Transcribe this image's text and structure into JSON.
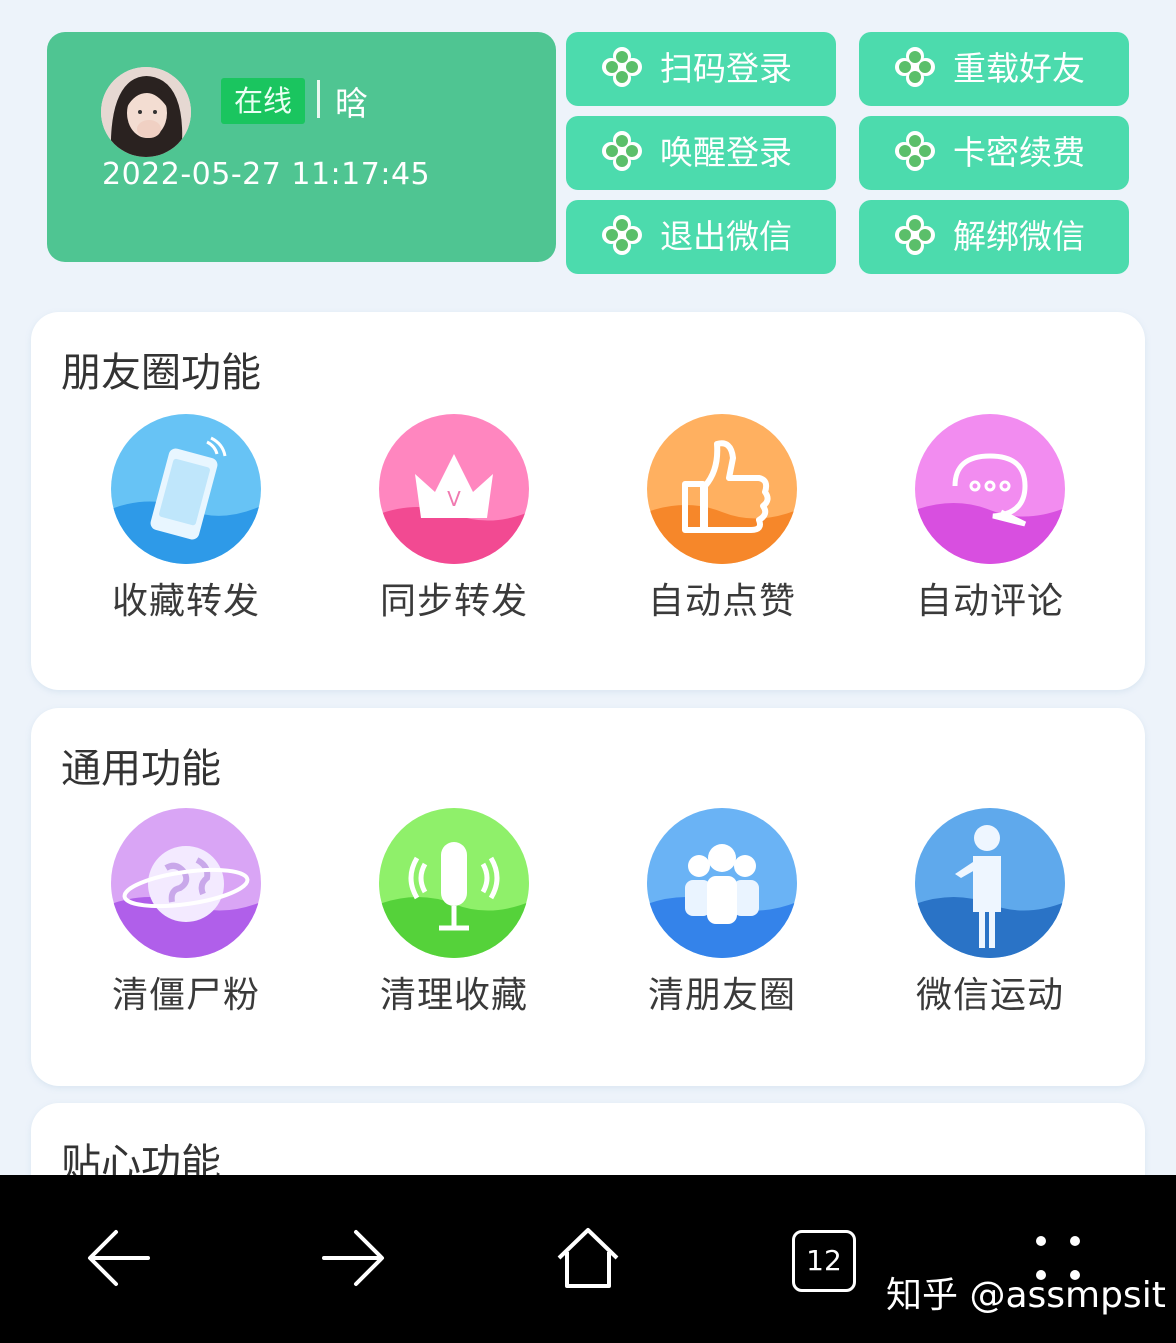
{
  "profile": {
    "status": "在线",
    "nickname": "晗",
    "login_time": "2022-05-27 11:17:45"
  },
  "actions": [
    {
      "label": "扫码登录",
      "icon": "clover-icon"
    },
    {
      "label": "重载好友",
      "icon": "clover-icon"
    },
    {
      "label": "唤醒登录",
      "icon": "clover-icon"
    },
    {
      "label": "卡密续费",
      "icon": "clover-icon"
    },
    {
      "label": "退出微信",
      "icon": "clover-icon"
    },
    {
      "label": "解绑微信",
      "icon": "clover-icon"
    }
  ],
  "sections": [
    {
      "title": "朋友圈功能",
      "items": [
        {
          "label": "收藏转发",
          "icon": "phone-icon",
          "color": "#3aa7f2"
        },
        {
          "label": "同步转发",
          "icon": "crown-icon",
          "color": "#f2559a"
        },
        {
          "label": "自动点赞",
          "icon": "thumbs-up-icon",
          "color": "#f58a2a"
        },
        {
          "label": "自动评论",
          "icon": "chat-bubble-icon",
          "color": "#dc4fe3"
        }
      ]
    },
    {
      "title": "通用功能",
      "items": [
        {
          "label": "清僵尸粉",
          "icon": "globe-icon",
          "color": "#b35ee8"
        },
        {
          "label": "清理收藏",
          "icon": "microphone-icon",
          "color": "#5ed83a"
        },
        {
          "label": "清朋友圈",
          "icon": "group-icon",
          "color": "#3c86ea"
        },
        {
          "label": "微信运动",
          "icon": "person-icon",
          "color": "#2f7fd0"
        }
      ]
    },
    {
      "title": "贴心功能",
      "items": []
    }
  ],
  "nav": {
    "tab_count": "12",
    "watermark": "知乎 @assmpsit"
  },
  "colors": {
    "profile_bg": "#4fc592",
    "button_bg": "#4cdbad",
    "badge_bg": "#1ac55f",
    "page_bg": "#edf3fa"
  }
}
